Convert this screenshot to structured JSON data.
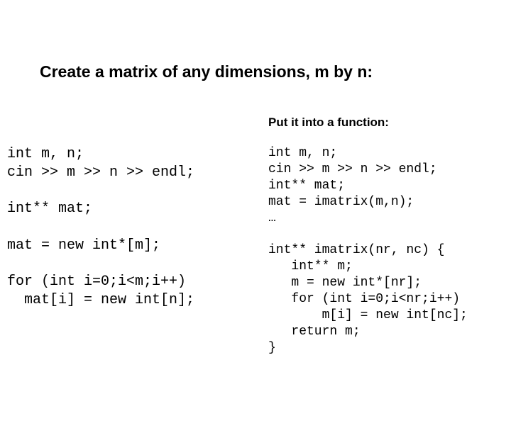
{
  "title": "Create a matrix of any dimensions, m by n:",
  "subtitle": "Put it into a function:",
  "left": {
    "block1": "int m, n;\ncin >> m >> n >> endl;",
    "block2": "int** mat;",
    "block3": "mat = new int*[m];",
    "block4": "for (int i=0;i<m;i++)\n  mat[i] = new int[n];"
  },
  "right": {
    "block1": "int m, n;\ncin >> m >> n >> endl;\nint** mat;\nmat = imatrix(m,n);\n…",
    "block2": "int** imatrix(nr, nc) {\n   int** m;\n   m = new int*[nr];\n   for (int i=0;i<nr;i++)\n       m[i] = new int[nc];\n   return m;\n}"
  }
}
